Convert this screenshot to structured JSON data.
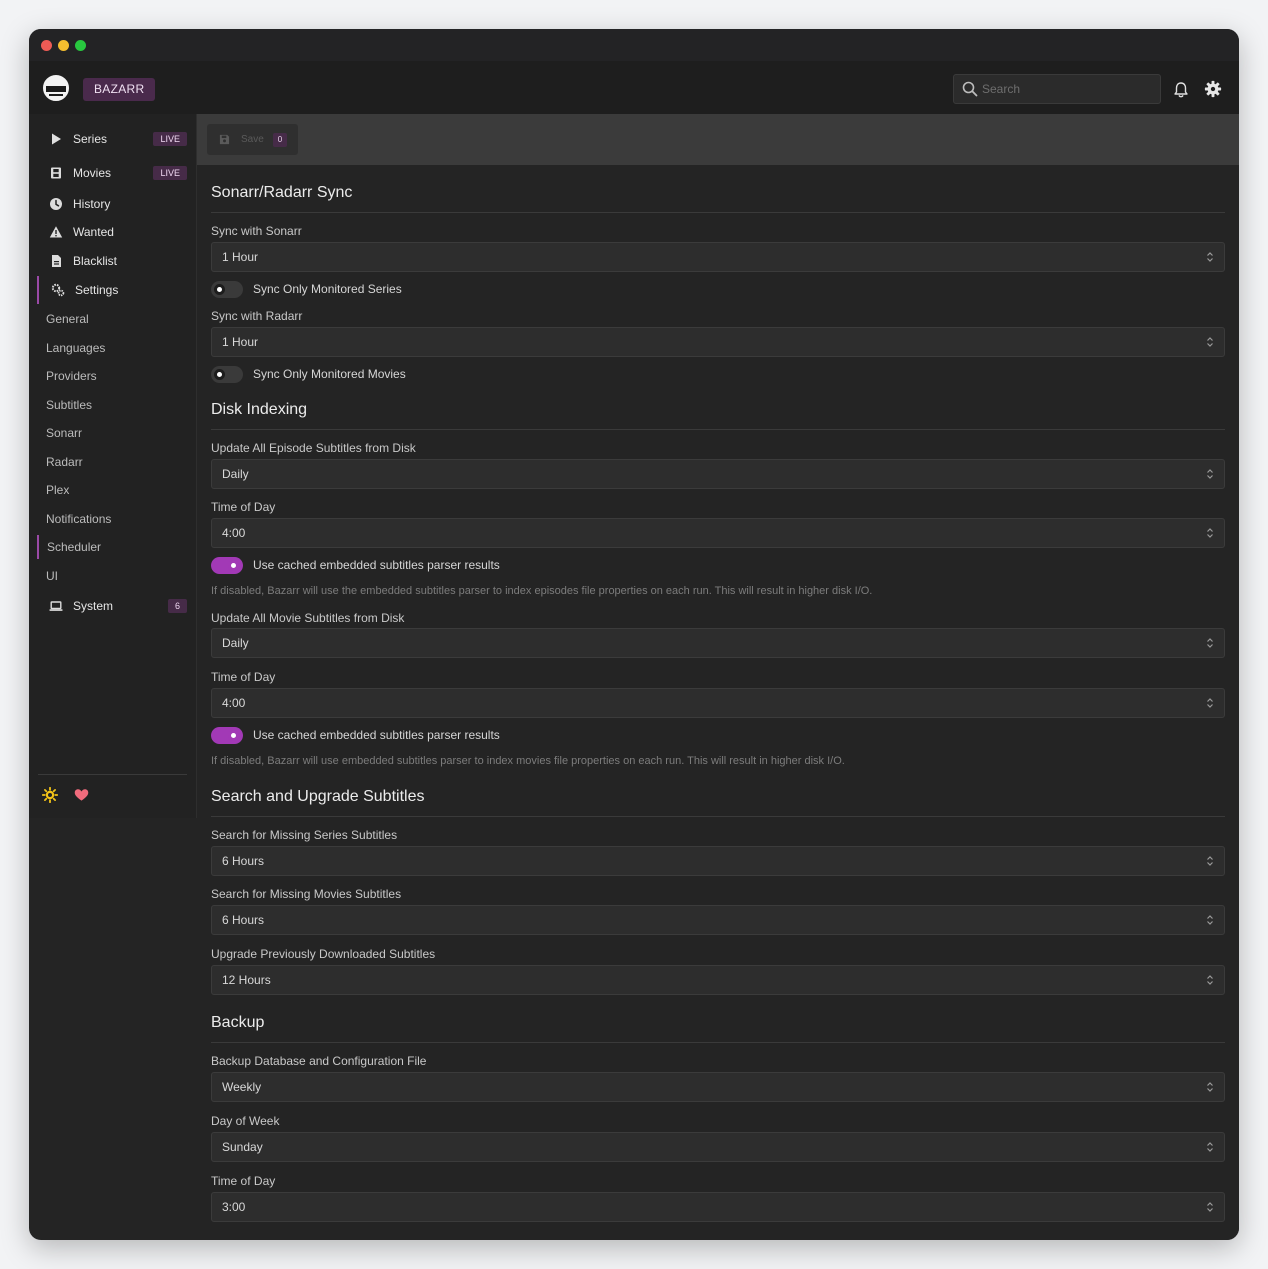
{
  "app": {
    "brand": "BAZARR"
  },
  "search": {
    "placeholder": "Search"
  },
  "sidebar": {
    "nav": [
      {
        "label": "Series",
        "badge": "LIVE"
      },
      {
        "label": "Movies",
        "badge": "LIVE"
      },
      {
        "label": "History"
      },
      {
        "label": "Wanted"
      },
      {
        "label": "Blacklist"
      },
      {
        "label": "Settings"
      }
    ],
    "settings_items": [
      "General",
      "Languages",
      "Providers",
      "Subtitles",
      "Sonarr",
      "Radarr",
      "Plex",
      "Notifications",
      "Scheduler",
      "UI"
    ],
    "system": {
      "label": "System",
      "badge": "6"
    }
  },
  "toolbar": {
    "save_label": "Save",
    "save_count": "0"
  },
  "sections": {
    "sync": {
      "title": "Sonarr/Radarr Sync",
      "sonarr_label": "Sync with Sonarr",
      "sonarr_value": "1 Hour",
      "sonarr_toggle": "Sync Only Monitored Series",
      "radarr_label": "Sync with Radarr",
      "radarr_value": "1 Hour",
      "radarr_toggle": "Sync Only Monitored Movies"
    },
    "disk": {
      "title": "Disk Indexing",
      "episode_label": "Update All Episode Subtitles from Disk",
      "episode_value": "Daily",
      "episode_time_label": "Time of Day",
      "episode_time_value": "4:00",
      "episode_toggle": "Use cached embedded subtitles parser results",
      "episode_help": "If disabled, Bazarr will use the embedded subtitles parser to index episodes file properties on each run. This will result in higher disk I/O.",
      "movie_label": "Update All Movie Subtitles from Disk",
      "movie_value": "Daily",
      "movie_time_label": "Time of Day",
      "movie_time_value": "4:00",
      "movie_toggle": "Use cached embedded subtitles parser results",
      "movie_help": "If disabled, Bazarr will use embedded subtitles parser to index movies file properties on each run. This will result in higher disk I/O."
    },
    "search": {
      "title": "Search and Upgrade Subtitles",
      "series_label": "Search for Missing Series Subtitles",
      "series_value": "6 Hours",
      "movies_label": "Search for Missing Movies Subtitles",
      "movies_value": "6 Hours",
      "upgrade_label": "Upgrade Previously Downloaded Subtitles",
      "upgrade_value": "12 Hours"
    },
    "backup": {
      "title": "Backup",
      "backup_label": "Backup Database and Configuration File",
      "backup_value": "Weekly",
      "day_label": "Day of Week",
      "day_value": "Sunday",
      "time_label": "Time of Day",
      "time_value": "3:00"
    }
  }
}
